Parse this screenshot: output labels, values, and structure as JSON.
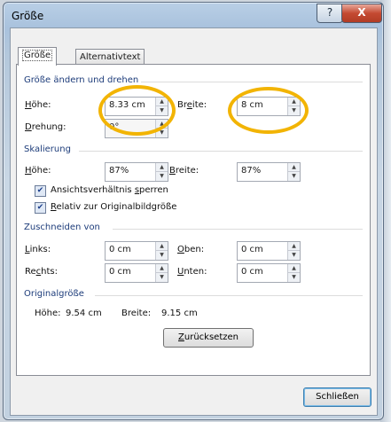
{
  "window": {
    "title": "Größe"
  },
  "tabs": [
    {
      "label": "Größe",
      "active": true
    },
    {
      "label": "Alternativtext",
      "active": false
    }
  ],
  "size_rotate": {
    "heading": "Größe ändern und drehen",
    "height_label": "Höhe:",
    "height_value": "8.33 cm",
    "width_label": "Breite:",
    "width_value": "8 cm",
    "rotation_label": "Drehung:",
    "rotation_value": "0°"
  },
  "scaling": {
    "heading": "Skalierung",
    "height_label": "Höhe:",
    "height_value": "87%",
    "width_label": "Breite:",
    "width_value": "87%",
    "lock_aspect_label": "Ansichtsverhältnis sperren",
    "lock_aspect_checked": true,
    "relative_label": "Relativ zur Originalbildgröße",
    "relative_checked": true
  },
  "crop": {
    "heading": "Zuschneiden von",
    "left_label": "Links:",
    "left_value": "0 cm",
    "top_label": "Oben:",
    "top_value": "0 cm",
    "right_label": "Rechts:",
    "right_value": "0 cm",
    "bottom_label": "Unten:",
    "bottom_value": "0 cm"
  },
  "original": {
    "heading": "Originalgröße",
    "height_label": "Höhe:",
    "height_value": "9.54 cm",
    "width_label": "Breite:",
    "width_value": "9.15 cm",
    "reset_label": "Zurücksetzen"
  },
  "footer": {
    "close_label": "Schließen"
  },
  "titlebar_buttons": {
    "help": "?",
    "close": "X"
  },
  "colors": {
    "highlight_ring": "#f2b404"
  }
}
